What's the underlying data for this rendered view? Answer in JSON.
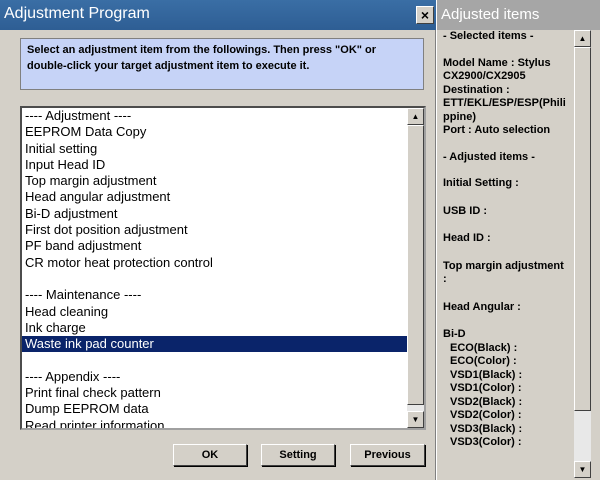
{
  "window": {
    "title": "Adjustment Program",
    "close_glyph": "×",
    "instruction": "Select an adjustment item from the followings. Then press \"OK\" or double-click your target adjustment item to execute it."
  },
  "list": {
    "items": [
      "---- Adjustment ----",
      "EEPROM Data Copy",
      "Initial setting",
      "Input Head ID",
      "Top margin adjustment",
      "Head angular adjustment",
      "Bi-D adjustment",
      "First dot position adjustment",
      "PF band adjustment",
      "CR motor heat protection control",
      "",
      "---- Maintenance ----",
      "Head cleaning",
      "Ink charge",
      "Waste ink pad counter",
      "",
      "---- Appendix ----",
      "Print final check pattern",
      "Dump EEPROM data",
      "Read printer information"
    ],
    "selected_index": 14
  },
  "buttons": {
    "ok": "OK",
    "setting": "Setting",
    "previous": "Previous"
  },
  "side_panel": {
    "title": "Adjusted items",
    "selected_header": "- Selected items -",
    "model_line1": "Model Name : Stylus",
    "model_line2": "CX2900/CX2905",
    "dest_line1": "Destination :",
    "dest_line2": "ETT/EKL/ESP/ESP(Phili",
    "dest_line3": "ppine)",
    "port": "Port : Auto selection",
    "adjusted_header": "- Adjusted items -",
    "initial_setting": "Initial Setting :",
    "usb_id": "USB ID :",
    "head_id": "Head ID :",
    "top_margin": "Top margin adjustment",
    "top_margin_colon": ":",
    "head_angular": "Head Angular :",
    "bid": "Bi-D",
    "bid_items": [
      "ECO(Black)  :",
      "ECO(Color)  :",
      "VSD1(Black) :",
      "VSD1(Color) :",
      "VSD2(Black) :",
      "VSD2(Color) :",
      "VSD3(Black) :",
      "VSD3(Color) :"
    ]
  },
  "icons": {
    "scroll_up": "▲",
    "scroll_down": "▼"
  },
  "colors": {
    "titlebar": "#3a6ea5",
    "selection": "#0a246a",
    "instruction_bg": "#c6d3f7"
  }
}
